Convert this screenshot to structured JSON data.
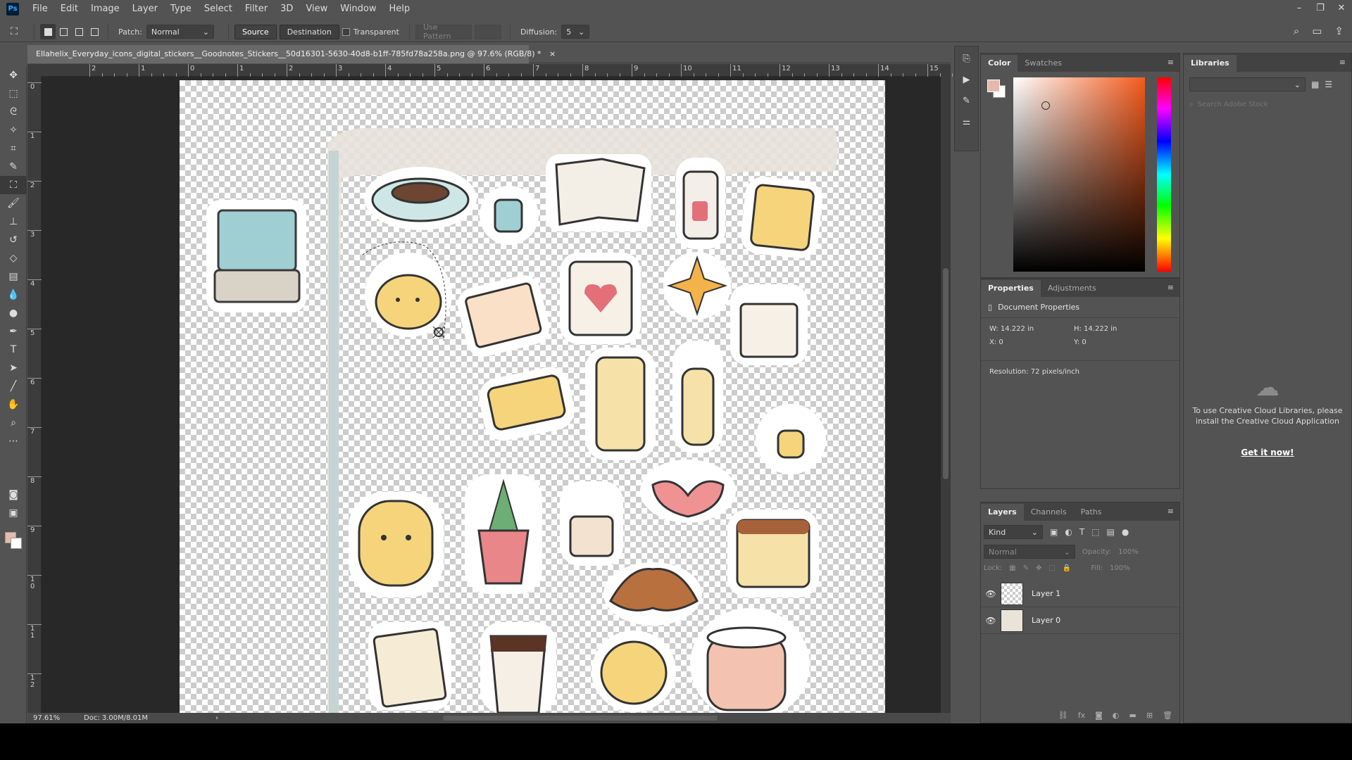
{
  "app": {
    "logo": "Ps"
  },
  "menu": [
    "File",
    "Edit",
    "Image",
    "Layer",
    "Type",
    "Select",
    "Filter",
    "3D",
    "View",
    "Window",
    "Help"
  ],
  "window_controls": [
    "–",
    "❐",
    "✕"
  ],
  "options": {
    "patch_label": "Patch:",
    "patch_value": "Normal",
    "source_label": "Source",
    "destination_label": "Destination",
    "transparent_label": "Transparent",
    "use_pattern_label": "Use Pattern",
    "diffusion_label": "Diffusion:",
    "diffusion_value": "5"
  },
  "document": {
    "title": "Ellahelix_Everyday_icons_digital_stickers__Goodnotes_Stickers__50d16301-5630-40d8-b1ff-785fd78a258a.png @ 97.6% (RGB/8) *",
    "close": "×"
  },
  "ruler": {
    "top": [
      "2",
      "1",
      "0",
      "1",
      "2",
      "3",
      "4",
      "5",
      "6",
      "7",
      "8",
      "9",
      "10",
      "11",
      "12",
      "13",
      "14",
      "15"
    ],
    "left": [
      "0",
      "1",
      "2",
      "3",
      "4",
      "5",
      "6",
      "7",
      "8",
      "9",
      "1 0",
      "1 1",
      "1 2"
    ]
  },
  "status": {
    "zoom": "97.61%",
    "doc": "Doc: 3.00M/8.01M"
  },
  "color_panel": {
    "tabs": [
      "Color",
      "Swatches"
    ],
    "fg": "#e6b9ae",
    "bg": "#ffffff"
  },
  "properties_panel": {
    "tabs": [
      "Properties",
      "Adjustments"
    ],
    "heading": "Document Properties",
    "w": "W:  14.222 in",
    "h": "H:  14.222 in",
    "x": "X:  0",
    "y": "Y:  0",
    "resolution": "Resolution: 72 pixels/inch"
  },
  "layers_panel": {
    "tabs": [
      "Layers",
      "Channels",
      "Paths"
    ],
    "filter": "Kind",
    "blend": "Normal",
    "opacity_label": "Opacity:",
    "opacity_value": "100%",
    "lock_label": "Lock:",
    "fill_label": "Fill:",
    "fill_value": "100%",
    "layers": [
      {
        "name": "Layer 1"
      },
      {
        "name": "Layer 0"
      }
    ]
  },
  "libraries": {
    "tab": "Libraries",
    "search_placeholder": "Search Adobe Stock",
    "message": "To use Creative Cloud Libraries, please install the Creative Cloud Application",
    "link": "Get it now!"
  }
}
